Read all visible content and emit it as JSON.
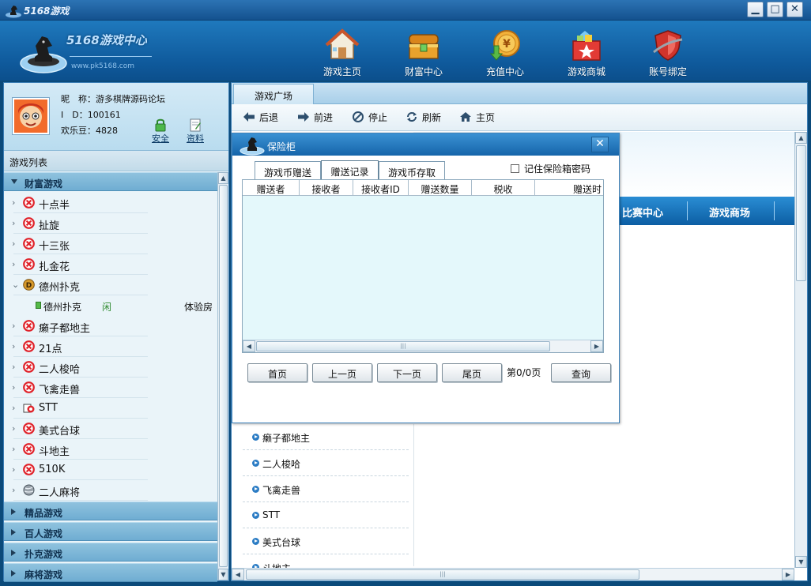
{
  "window": {
    "title": "5168游戏",
    "minimize": "▁",
    "maximize": "□",
    "close": "✕"
  },
  "brand": {
    "title": "5168游戏中心",
    "url": "www.pk5168.com"
  },
  "nav": [
    {
      "label": "游戏主页",
      "icon": "house-icon"
    },
    {
      "label": "财富中心",
      "icon": "treasure-chest-icon"
    },
    {
      "label": "充值中心",
      "icon": "coin-yuan-icon"
    },
    {
      "label": "游戏商城",
      "icon": "gift-box-icon"
    },
    {
      "label": "账号绑定",
      "icon": "shield-icon"
    }
  ],
  "user": {
    "nickname_label": "昵　称：",
    "nickname": "游多棋牌源码论坛",
    "id_label": "I　D：",
    "id": "100161",
    "beans_label": "欢乐豆：",
    "beans": "4828",
    "security_label": "安全",
    "profile_label": "资料"
  },
  "game_list": {
    "title": "游戏列表",
    "categories": [
      "财富游戏",
      "精品游戏",
      "百人游戏",
      "扑克游戏",
      "麻将游戏"
    ],
    "games": [
      "十点半",
      "扯旋",
      "十三张",
      "扎金花",
      "德州扑克",
      "癞子都地主",
      "21点",
      "二人梭哈",
      "飞禽走兽",
      "STT",
      "美式台球",
      "斗地主",
      "510K",
      "二人麻将"
    ],
    "room": {
      "name": "德州扑克",
      "status": "闲",
      "type": "体验房"
    }
  },
  "content": {
    "tab": "游戏广场",
    "toolbar": {
      "back": "后退",
      "forward": "前进",
      "stop": "停止",
      "refresh": "刷新",
      "home": "主页"
    },
    "banner_nav": [
      "比赛中心",
      "游戏商场"
    ],
    "sub_items": [
      "癞子都地主",
      "二人梭哈",
      "飞禽走兽",
      "STT",
      "美式台球",
      "斗地主"
    ]
  },
  "dialog": {
    "title": "保险柜",
    "close": "✕",
    "tabs": [
      "游戏币赠送",
      "赠送记录",
      "游戏币存取"
    ],
    "active_tab": "赠送记录",
    "remember": "记住保险箱密码",
    "columns": [
      "赠送者",
      "接收者",
      "接收者ID",
      "赠送数量",
      "税收",
      "赠送时"
    ],
    "buttons": {
      "first": "首页",
      "prev": "上一页",
      "next": "下一页",
      "last": "尾页",
      "query": "查询"
    },
    "page_info": "第0/0页"
  },
  "colors": {
    "accent": "#1665aa",
    "category": "#7fb8d8",
    "grid_bg": "#e4f8fb",
    "forbidden": "#e0232b"
  }
}
